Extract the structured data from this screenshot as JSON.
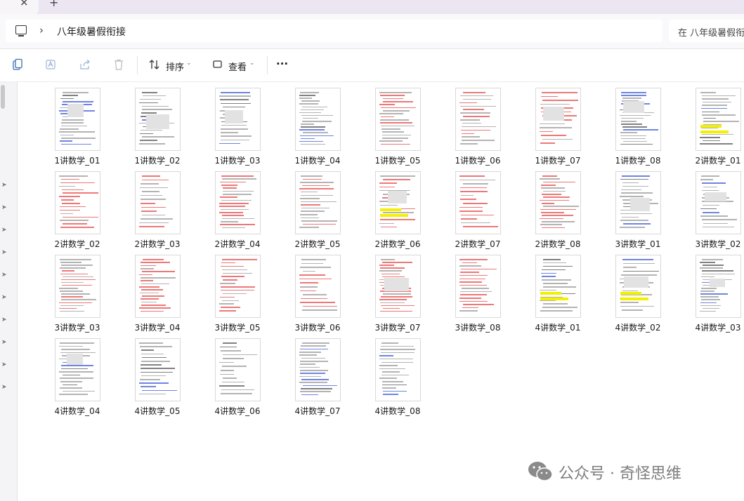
{
  "window": {
    "close_glyph": "×",
    "new_tab_glyph": "+"
  },
  "address": {
    "chevron": "›",
    "crumb": "八年级暑假衔接",
    "search_placeholder": "在 八年级暑假衔"
  },
  "toolbar": {
    "sort_label": "排序",
    "view_label": "查看",
    "more_glyph": "···",
    "caret_glyph": "⌄"
  },
  "files": [
    {
      "name": "1讲数学_01"
    },
    {
      "name": "1讲数学_02"
    },
    {
      "name": "1讲数学_03"
    },
    {
      "name": "1讲数学_04"
    },
    {
      "name": "1讲数学_05"
    },
    {
      "name": "1讲数学_06"
    },
    {
      "name": "1讲数学_07"
    },
    {
      "name": "1讲数学_08"
    },
    {
      "name": "2讲数学_01"
    },
    {
      "name": "2讲数学_02"
    },
    {
      "name": "2讲数学_03"
    },
    {
      "name": "2讲数学_04"
    },
    {
      "name": "2讲数学_05"
    },
    {
      "name": "2讲数学_06"
    },
    {
      "name": "2讲数学_07"
    },
    {
      "name": "2讲数学_08"
    },
    {
      "name": "3讲数学_01"
    },
    {
      "name": "3讲数学_02"
    },
    {
      "name": "3讲数学_03"
    },
    {
      "name": "3讲数学_04"
    },
    {
      "name": "3讲数学_05"
    },
    {
      "name": "3讲数学_06"
    },
    {
      "name": "3讲数学_07"
    },
    {
      "name": "3讲数学_08"
    },
    {
      "name": "4讲数学_01"
    },
    {
      "name": "4讲数学_02"
    },
    {
      "name": "4讲数学_03"
    },
    {
      "name": "4讲数学_04"
    },
    {
      "name": "4讲数学_05"
    },
    {
      "name": "4讲数学_06"
    },
    {
      "name": "4讲数学_07"
    },
    {
      "name": "4讲数学_08"
    }
  ],
  "watermark": {
    "text": "公众号 · 奇怪思维",
    "icon": "wechat-icon"
  },
  "colors": {
    "accent": "#0067c0",
    "thumb_red_text": "#e84a4a",
    "thumb_blue_text": "#3d5bd9",
    "highlight": "#f4f000"
  }
}
